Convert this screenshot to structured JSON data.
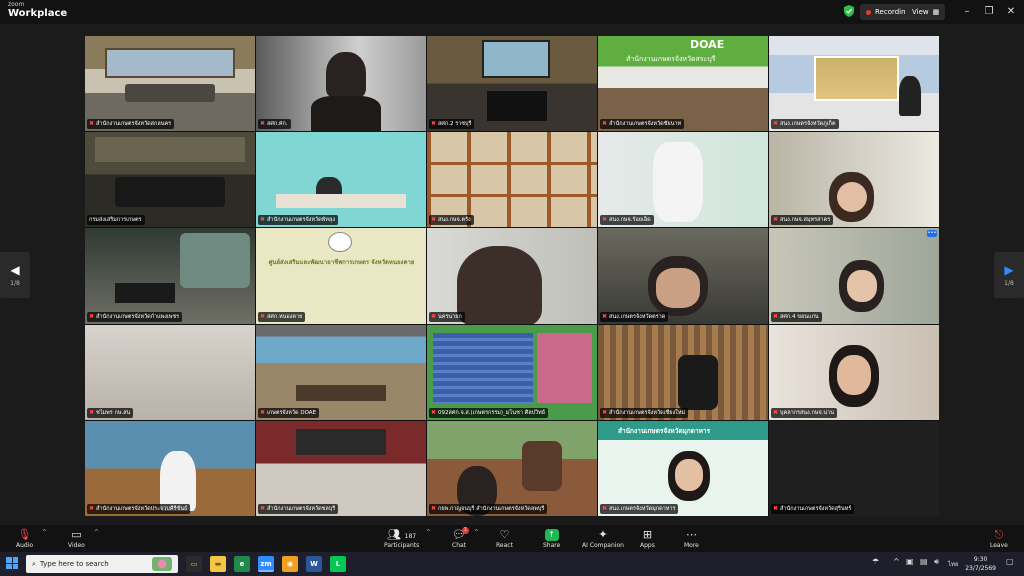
{
  "app": {
    "brand_small": "zoom",
    "brand_big": "Workplace"
  },
  "titlebar": {
    "recording_label": "Recording",
    "view_label": "View"
  },
  "gallery": {
    "tiles": [
      {
        "label": "สำนักงานเกษตรจังหวัดสกลนคร",
        "mic_off": true
      },
      {
        "label": "สศก.ศก.",
        "mic_off": true
      },
      {
        "label": "สศก.2 ราชบุรี",
        "mic_off": true
      },
      {
        "label": "สำนักงานเกษตรจังหวัดชัยนาท",
        "mic_off": true
      },
      {
        "label": "สนง.เกษตรจังหวัดภูเก็ต",
        "mic_off": true
      },
      {
        "label": "กรมส่งเสริมการเกษตร",
        "mic_off": false
      },
      {
        "label": "สำนักงานเกษตรจังหวัดพัทลุง",
        "mic_off": true
      },
      {
        "label": "สนง.กษจ.ตรัง",
        "mic_off": true
      },
      {
        "label": "สนง.กษจ.ร้อยเอ็ด",
        "mic_off": true
      },
      {
        "label": "สนง.กษจ.สมุทรสาคร",
        "mic_off": true
      },
      {
        "label": "สำนักงานเกษตรจังหวัดกำแพงเพชร",
        "mic_off": true
      },
      {
        "label": "สศก.หนองคาย",
        "mic_off": true
      },
      {
        "label": "นครนายก",
        "mic_off": true
      },
      {
        "label": "สนง.เกษตรจังหวัดตราด",
        "mic_off": true
      },
      {
        "label": "สศก.4 ขอนแก่น",
        "mic_off": true
      },
      {
        "label": "ชไมพร กษ.สน",
        "mic_off": true
      },
      {
        "label": "เกษตรจังหวัด DOAE",
        "mic_off": true
      },
      {
        "label": "092สศก.จ.ส.(เกษตรกรรม)_มโนชา ศิลปวิทย์",
        "mic_off": true
      },
      {
        "label": "สำนักงานเกษตรจังหวัดเชียงใหม่",
        "mic_off": true
      },
      {
        "label": "บุคลากรสนง.กษจ.น่าน",
        "mic_off": true
      },
      {
        "label": "สำนักงานเกษตรจังหวัดประจวบคีรีขันธ์",
        "mic_off": true
      },
      {
        "label": "สำนักงานเกษตรจังหวัดชลบุรี",
        "mic_off": true
      },
      {
        "label": "กยพ.กาญจนบุรี สำนักงานเกษตรจังหวัดลพบุรี",
        "mic_off": true
      },
      {
        "label": "สนง.เกษตรจังหวัดมุกดาหาร",
        "mic_off": true
      },
      {
        "label": "สำนักงานเกษตรจังหวัดสุรินทร์",
        "mic_off": true
      }
    ],
    "tile_texts": {
      "doae_banner": "DOAE",
      "doae_office": "สำนักงานเกษตรจังหวัดสระบุรี",
      "nongkhai_title": "ศูนย์ส่งเสริมและพัฒนาอาชีพการเกษตร จังหวัดหนองคาย",
      "mukdahan_banner": "สำนักงานเกษตรจังหวัดมุกดาหาร"
    },
    "page_left": "1/8",
    "page_right": "1/8"
  },
  "toolbar": {
    "audio": "Audio",
    "video": "Video",
    "participants": "Participants",
    "participants_count": "187",
    "chat": "Chat",
    "chat_badge": "1",
    "react": "React",
    "share": "Share",
    "ai_companion": "AI Companion",
    "apps": "Apps",
    "more": "More",
    "leave": "Leave"
  },
  "taskbar": {
    "search_placeholder": "Type here to search",
    "time": "9:30",
    "date": "23/7/2569",
    "lang": "ไทย"
  },
  "colors": {
    "accent_green": "#24c24a",
    "recording_red": "#e63838",
    "leave_red": "#ff3d3d",
    "share_green": "#1db954"
  }
}
